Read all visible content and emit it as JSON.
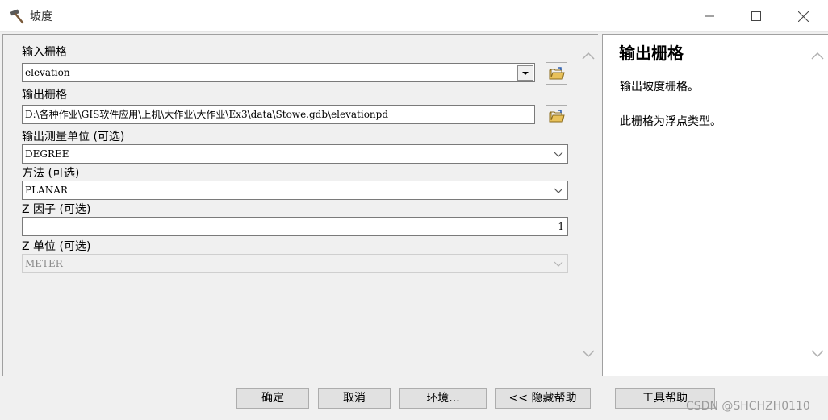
{
  "window": {
    "title": "坡度",
    "controls": {
      "minimize": "minimize",
      "maximize": "maximize",
      "close": "close"
    }
  },
  "form": {
    "input_raster": {
      "label": "输入栅格",
      "value": "elevation"
    },
    "output_raster": {
      "label": "输出栅格",
      "value": "D:\\各种作业\\GIS软件应用\\上机\\大作业\\大作业\\Ex3\\data\\Stowe.gdb\\elevationpd"
    },
    "measurement": {
      "label": "输出测量单位 (可选)",
      "value": "DEGREE"
    },
    "method": {
      "label": "方法 (可选)",
      "value": "PLANAR"
    },
    "z_factor": {
      "label": "Z 因子 (可选)",
      "value": "1"
    },
    "z_unit": {
      "label": "Z 单位 (可选)",
      "value": "METER"
    }
  },
  "help": {
    "title": "输出栅格",
    "paragraphs": [
      "输出坡度栅格。",
      "此栅格为浮点类型。"
    ]
  },
  "buttons": {
    "ok": "确定",
    "cancel": "取消",
    "environments": "环境...",
    "hide_help": "<< 隐藏帮助",
    "tool_help": "工具帮助"
  },
  "watermark": "CSDN @SHCHZH0110",
  "icons": {
    "title": "hammer-icon",
    "folder": "folder-icon",
    "combo": "chevron-down-icon",
    "scroll_up": "chevron-up-icon",
    "scroll_down": "chevron-down-icon"
  }
}
